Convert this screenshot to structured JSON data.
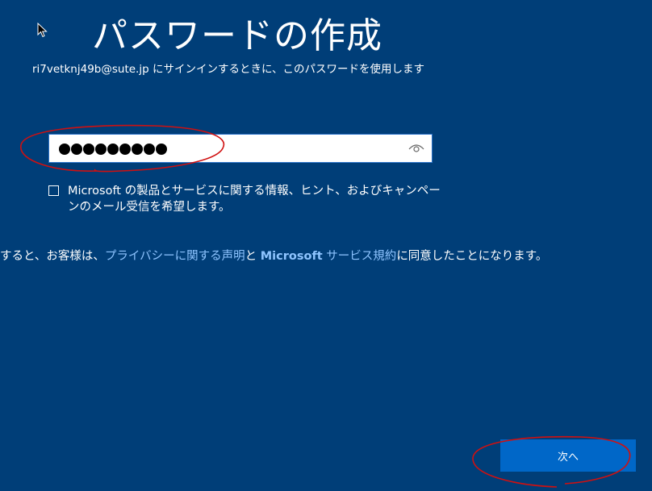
{
  "title": "パスワードの作成",
  "subtitle": "ri7vetknj49b@sute.jp にサインインするときに、このパスワードを使用します",
  "password": {
    "mask_count": 9,
    "reveal_icon": "eye-icon"
  },
  "marketing_opt_in": {
    "checked": false,
    "label": "Microsoft の製品とサービスに関する情報、ヒント、およびキャンペーンのメール受信を希望します。"
  },
  "consent": {
    "prefix": "すると、お客様は、",
    "privacy_link": "プライバシーに関する声明",
    "and": "と ",
    "ms_label": "Microsoft",
    "terms_link": " サービス規約",
    "suffix": "に同意したことになります。"
  },
  "next_button": "次へ",
  "colors": {
    "background": "#003e78",
    "button": "#0067c8",
    "link": "#8ec4ff",
    "annotation": "#d01010"
  }
}
